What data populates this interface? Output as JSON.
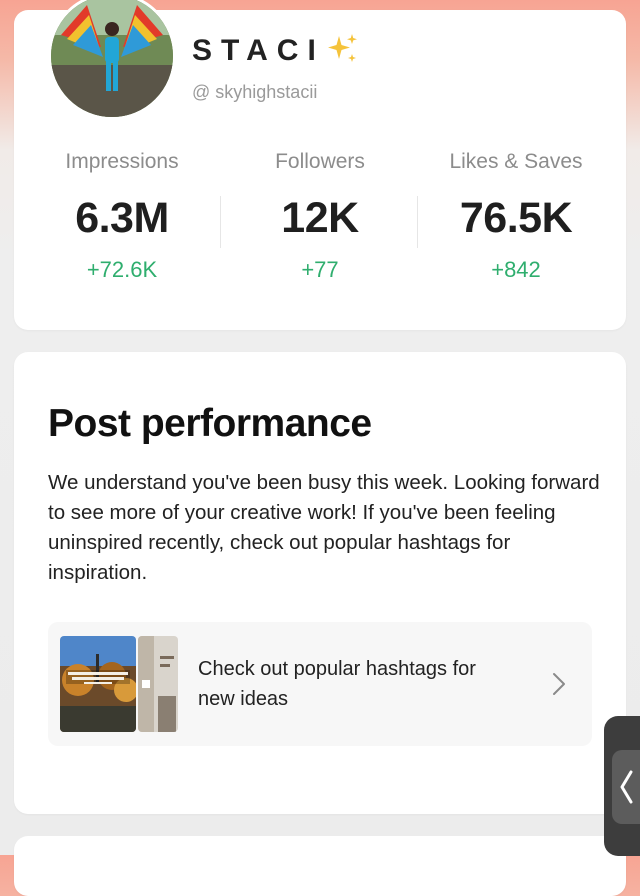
{
  "profile": {
    "name": "STACI",
    "handle": "@ skyhighstacii",
    "avatar_icon": "profile-photo",
    "sparkle_icon": "sparkles-emoji"
  },
  "stats": [
    {
      "label": "Impressions",
      "value": "6.3M",
      "delta": "+72.6K"
    },
    {
      "label": "Followers",
      "value": "12K",
      "delta": "+77"
    },
    {
      "label": "Likes & Saves",
      "value": "76.5K",
      "delta": "+842"
    }
  ],
  "post_performance": {
    "title": "Post performance",
    "body": "We understand you've been busy this week. Looking forward to see more of your creative work! If you've been feeling uninspired recently, check out popular hashtags for inspiration.",
    "hashtag_link": {
      "text": "Check out popular hashtags for new ideas",
      "thumbnail_icon": "hashtag-preview-images",
      "chevron_icon": "chevron-right-icon"
    }
  },
  "side_handle_icon": "chevron-left-icon",
  "colors": {
    "delta_green": "#2fae6e",
    "header_gradient_top": "#f7a493",
    "card_bg": "#ffffff"
  }
}
